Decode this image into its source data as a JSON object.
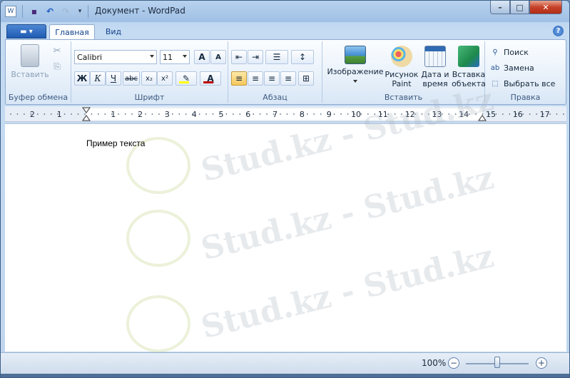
{
  "window": {
    "title": "Документ - WordPad"
  },
  "title_buttons": {
    "minimize": "–",
    "maximize": "□",
    "close": "✕"
  },
  "qat": {
    "save": "▪",
    "undo": "↶",
    "redo": "↷",
    "customize": "▾",
    "app_icon": "W"
  },
  "tabs": {
    "app_menu": "▬ ▾",
    "home": "Главная",
    "view": "Вид",
    "help": "?"
  },
  "clipboard": {
    "paste": "Вставить",
    "cut": "✂",
    "copy": "⎘",
    "label": "Буфер обмена"
  },
  "font": {
    "name": "Calibri",
    "size": "11",
    "grow": "A",
    "shrink": "A",
    "bold": "Ж",
    "italic": "К",
    "underline": "Ч",
    "strike": "abc",
    "sub": "x₂",
    "sup": "x²",
    "highlight": "✎",
    "color": "A",
    "label": "Шрифт",
    "highlight_color": "#ffff00",
    "font_color": "#c00000"
  },
  "paragraph": {
    "indent_dec": "⇤",
    "indent_inc": "⇥",
    "list": "☰",
    "spacing": "↕",
    "align_left": "≡",
    "align_center": "≡",
    "align_right": "≡",
    "align_justify": "≡",
    "dialog": "⊞",
    "label": "Абзац"
  },
  "insert": {
    "image": "Изображение",
    "paint_1": "Рисунок",
    "paint_2": "Paint",
    "datetime_1": "Дата и",
    "datetime_2": "время",
    "object_1": "Вставка",
    "object_2": "объекта",
    "label": "Вставить"
  },
  "edit": {
    "find": "Поиск",
    "replace": "Замена",
    "select_all": "Выбрать все",
    "label": "Правка"
  },
  "ruler": {
    "left_ticks": [
      "2",
      "1"
    ],
    "ticks": [
      "1",
      "2",
      "3",
      "4",
      "5",
      "6",
      "7",
      "8",
      "9",
      "10",
      "11",
      "12",
      "13",
      "14",
      "15",
      "16",
      "17"
    ]
  },
  "document": {
    "text": "Пример текста"
  },
  "status": {
    "zoom": "100%",
    "zoom_out": "−",
    "zoom_in": "+",
    "zoom_fraction": 0.5
  },
  "watermark": {
    "text": "Stud.kz - Stud.kz"
  }
}
